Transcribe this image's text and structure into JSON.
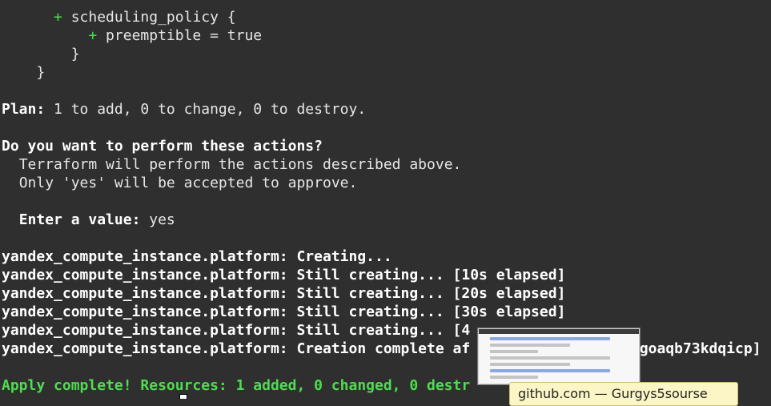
{
  "terminal": {
    "lines": [
      {
        "indent": "      ",
        "prefix": "+",
        "text": " scheduling_policy {"
      },
      {
        "indent": "          ",
        "prefix": "+",
        "text": " preemptible = true"
      },
      {
        "indent": "        ",
        "prefix": "",
        "text": "}"
      },
      {
        "indent": "    ",
        "prefix": "",
        "text": "}"
      },
      {
        "indent": "",
        "prefix": "",
        "text": ""
      },
      {
        "bold": "Plan:",
        "text": " 1 to add, 0 to change, 0 to destroy."
      },
      {
        "indent": "",
        "prefix": "",
        "text": ""
      },
      {
        "bold": "Do you want to perform these actions?",
        "text": ""
      },
      {
        "indent": "  ",
        "prefix": "",
        "text": "Terraform will perform the actions described above."
      },
      {
        "indent": "  ",
        "prefix": "",
        "text": "Only 'yes' will be accepted to approve."
      },
      {
        "indent": "",
        "prefix": "",
        "text": ""
      },
      {
        "indent": "  ",
        "bold": "Enter a value:",
        "text": " yes"
      },
      {
        "indent": "",
        "prefix": "",
        "text": ""
      },
      {
        "bold": "yandex_compute_instance.platform: Creating...",
        "text": ""
      },
      {
        "bold": "yandex_compute_instance.platform: Still creating... [10s elapsed]",
        "text": ""
      },
      {
        "bold": "yandex_compute_instance.platform: Still creating... [20s elapsed]",
        "text": ""
      },
      {
        "bold": "yandex_compute_instance.platform: Still creating... [30s elapsed]",
        "text": ""
      },
      {
        "bold": "yandex_compute_instance.platform: Still creating... [4",
        "text": ""
      },
      {
        "bold": "yandex_compute_instance.platform: Creation complete af",
        "text": "",
        "tail": "ugoaqb73kdqicp]"
      },
      {
        "indent": "",
        "prefix": "",
        "text": ""
      },
      {
        "green": "Apply complete! Resources: 1 added, 0 changed, 0 destr",
        "text": ""
      }
    ]
  },
  "overlay": {
    "tooltip_text": "github.com — Gurgys5sourse"
  },
  "colors": {
    "background": "#2f2f2f",
    "plus": "#4fdc4f",
    "text": "#e6e6e6"
  }
}
